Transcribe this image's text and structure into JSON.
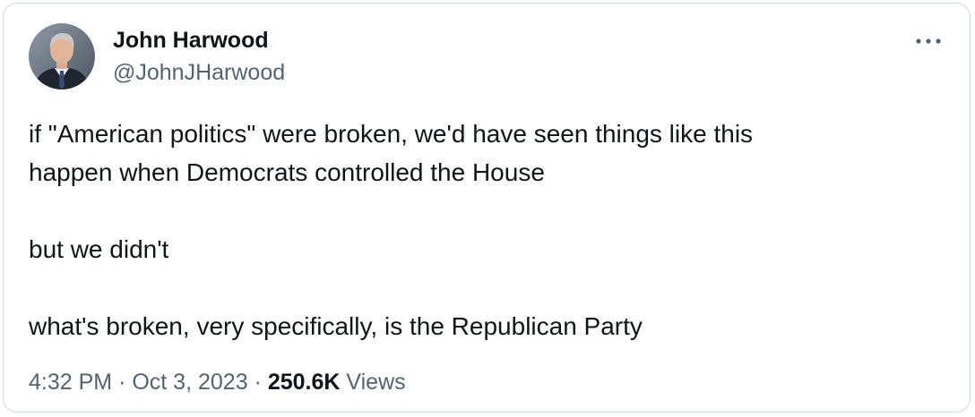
{
  "author": {
    "name": "John Harwood",
    "handle": "@JohnJHarwood"
  },
  "tweet": {
    "lines": [
      "if \"American politics\" were broken, we'd have seen things like this",
      "happen when Democrats controlled the House",
      "",
      "but we didn't",
      "",
      "what's broken, very specifically, is the Republican Party"
    ]
  },
  "meta": {
    "time": "4:32 PM",
    "separator": "·",
    "date": "Oct 3, 2023",
    "views_count": "250.6K",
    "views_label": "Views"
  },
  "icons": {
    "more": "more-dots-icon",
    "avatar": "avatar"
  }
}
